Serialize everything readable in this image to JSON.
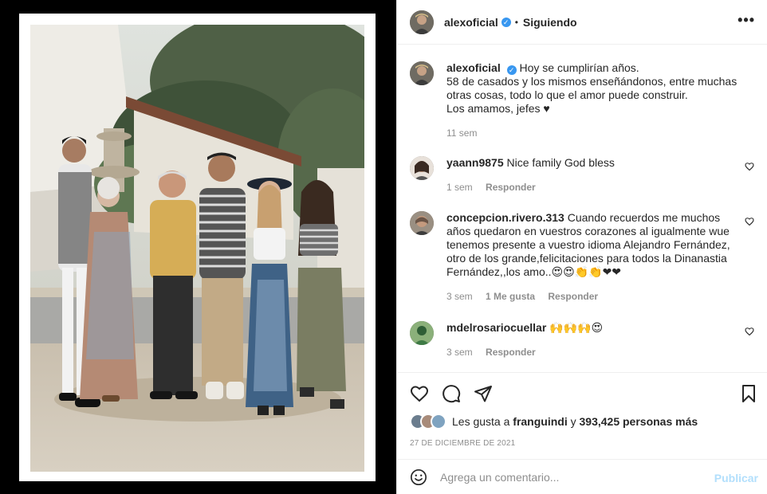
{
  "header": {
    "username": "alexoficial",
    "verified_mark": "✓",
    "separator": "•",
    "follow_status": "Siguiendo",
    "more_icon": "more-horizontal-icon",
    "more_label": "•••"
  },
  "caption": {
    "username": "alexoficial",
    "text_line1": "Hoy se cumplirían años.",
    "text_rest": "58 de casados y los mismos enseñándonos, entre muchas otras cosas, todo lo que el amor puede construir.",
    "text_last": "Los amamos, jefes ♥",
    "time": "11 sem"
  },
  "comments": [
    {
      "username": "yaann9875",
      "text": "Nice family God bless",
      "time": "1 sem",
      "likes": "",
      "reply": "Responder"
    },
    {
      "username": "concepcion.rivero.313",
      "text": "Cuando recuerdos me muchos años quedaron en vuestros corazones al igualmente wue tenemos presente a vuestro idioma Alejandro Fernández, otro de los grande,felicitaciones para todos la Dinanastia Fernández,,los amo..😍😍👏👏❤❤",
      "time": "3 sem",
      "likes": "1 Me gusta",
      "reply": "Responder"
    },
    {
      "username": "mdelrosariocuellar",
      "text": "🙌🙌🙌😍",
      "time": "3 sem",
      "likes": "",
      "reply": "Responder"
    }
  ],
  "actions": {
    "like_icon": "heart-icon",
    "comment_icon": "comment-icon",
    "share_icon": "paper-plane-icon",
    "save_icon": "bookmark-icon"
  },
  "likes": {
    "prefix": "Les gusta a",
    "user": "franguindi",
    "connector": "y",
    "count": "393,425 personas más"
  },
  "date": "27 DE DICIEMBRE DE 2021",
  "add_comment": {
    "placeholder": "Agrega un comentario...",
    "post_label": "Publicar"
  },
  "colors": {
    "verified": "#3897f0",
    "post_disabled": "#b2dffc",
    "muted": "#8e8e8e",
    "text": "#262626"
  }
}
